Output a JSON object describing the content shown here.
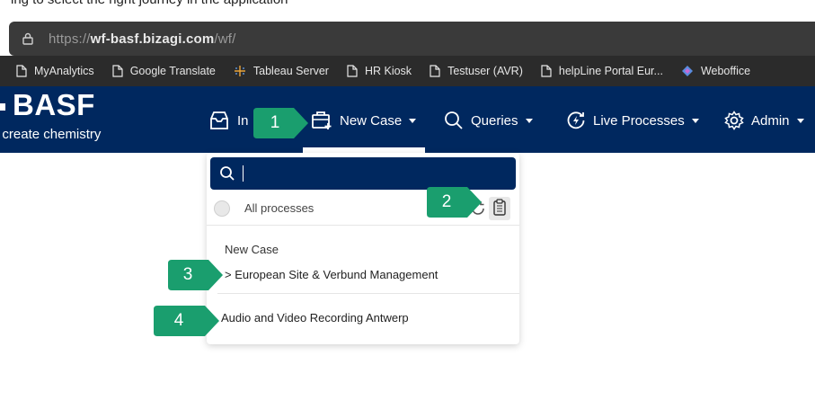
{
  "doc_text": "ing to select the right journey in the application",
  "browser": {
    "url_prefix": "https://",
    "url_domain": "wf-basf.bizagi.com",
    "url_path": "/wf/"
  },
  "bookmarks": [
    {
      "label": "MyAnalytics",
      "icon": "page-icon"
    },
    {
      "label": "Google Translate",
      "icon": "page-icon"
    },
    {
      "label": "Tableau Server",
      "icon": "tableau-icon"
    },
    {
      "label": "HR Kiosk",
      "icon": "page-icon"
    },
    {
      "label": "Testuser (AVR)",
      "icon": "page-icon"
    },
    {
      "label": "helpLine Portal Eur...",
      "icon": "page-icon"
    },
    {
      "label": "Weboffice",
      "icon": "weboffice-icon"
    }
  ],
  "app": {
    "brand": "BASF",
    "tagline": "We create chemistry",
    "nav": {
      "inbox_label": "In",
      "new_case_label": "New Case",
      "queries_label": "Queries",
      "live_processes_label": "Live Processes",
      "admin_label": "Admin"
    }
  },
  "dropdown": {
    "search_value": "",
    "filter_label": "All processes",
    "group_label": "New Case",
    "items": [
      "> European Site & Verbund Management",
      "Audio and Video Recording Antwerp"
    ]
  },
  "callouts": [
    "1",
    "2",
    "3",
    "4"
  ],
  "colors": {
    "app_header": "#00285f",
    "callout": "#1a9e6e",
    "browser_bar": "#3a3a3a"
  }
}
